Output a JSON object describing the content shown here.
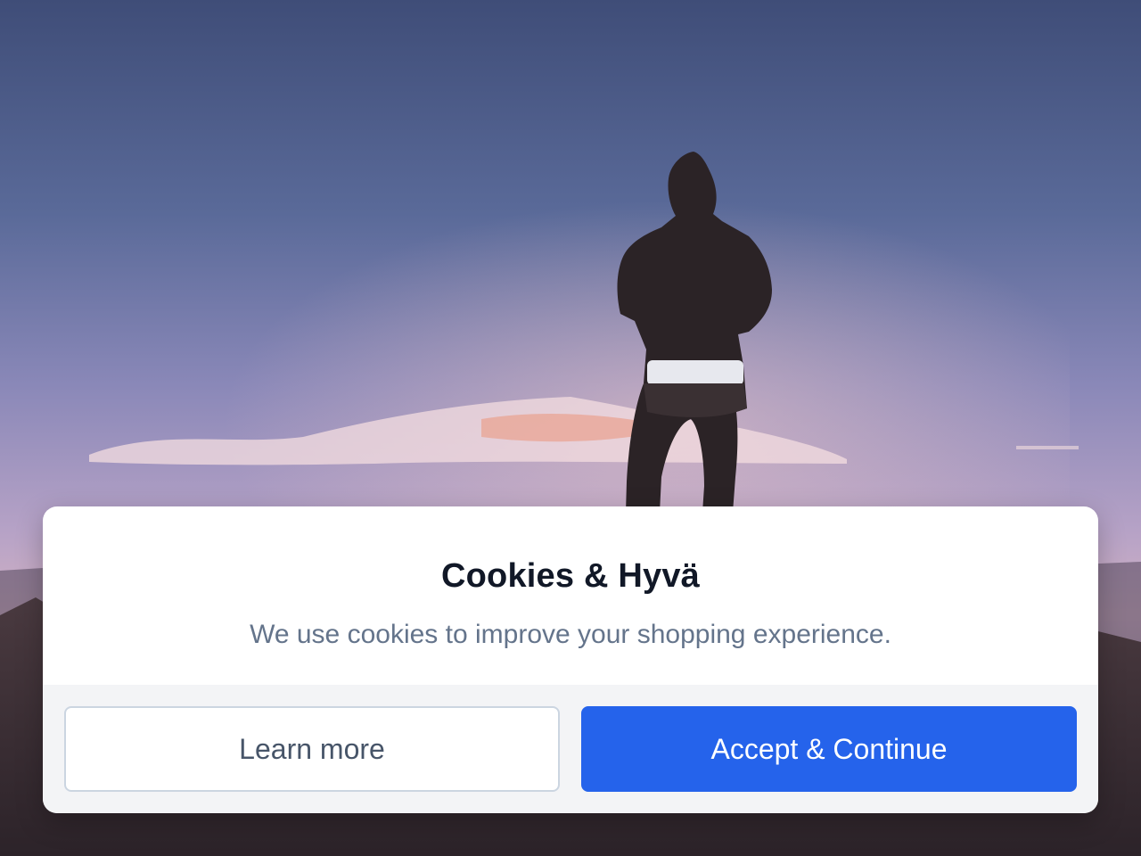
{
  "background": {
    "description_icon": "person-on-mountain-photo"
  },
  "cookie_modal": {
    "title": "Cookies & Hyvä",
    "message": "We use cookies to improve your shopping experience.",
    "learn_more_label": "Learn more",
    "accept_label": "Accept & Continue"
  },
  "colors": {
    "primary": "#2563eb",
    "title": "#111827",
    "message": "#64748b",
    "footer_bg": "#f3f4f6"
  }
}
